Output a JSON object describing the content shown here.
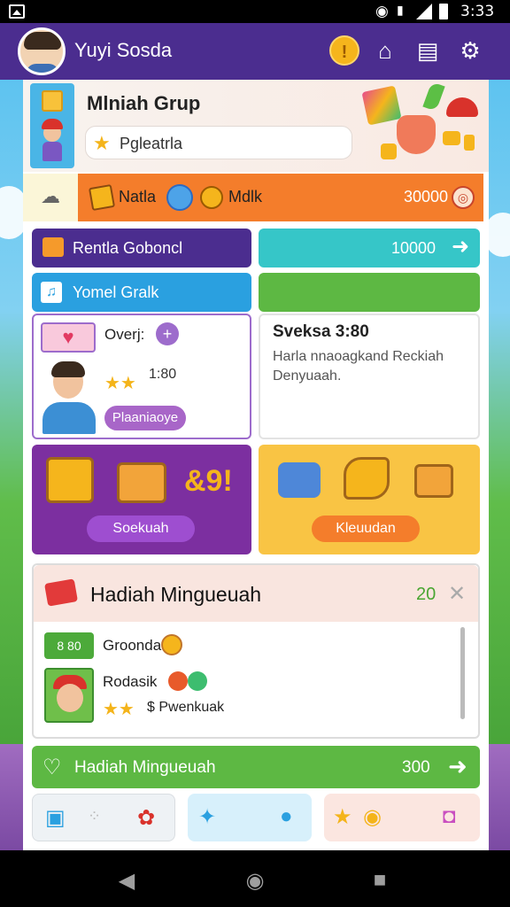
{
  "status_bar": {
    "time": "3:33"
  },
  "header": {
    "user_name": "Yuyi Sosda",
    "coin_label": "!"
  },
  "top_card": {
    "title": "Mlniah Grup",
    "search_value": "Pgleatrla"
  },
  "orange_bar": {
    "label1": "Natla",
    "label2": "Mdlk",
    "value": "30000"
  },
  "buttons": {
    "purple_label": "Rentla Goboncl",
    "teal_label": "10000",
    "blue_label": "Yomel Gralk"
  },
  "left_card": {
    "title": "Overj:",
    "score": "1:80",
    "pill": "Plaaniaoye"
  },
  "right_card": {
    "title": "Sveksa 3:80",
    "description": "Harla nnaoagkand Reckiah Denyuaah."
  },
  "prizes": {
    "left_big": "&9!",
    "left_pill": "Soekuah",
    "right_pill": "Kleuudan"
  },
  "weekly": {
    "title": "Hadiah Mingueuah",
    "count": "20",
    "row1_badge": "8 80",
    "row1_name": "Groonda",
    "row2_name": "Rodasik",
    "row2_meta": "$ Pwenkuak"
  },
  "green_bar": {
    "label": "Hadiah Mingueuah",
    "value": "300"
  },
  "colors": {
    "header": "#4b2d8f",
    "orange": "#f47d2b",
    "teal": "#36c6c8",
    "green": "#5db843",
    "purple": "#7c2fa0",
    "yellow": "#f9c444"
  }
}
